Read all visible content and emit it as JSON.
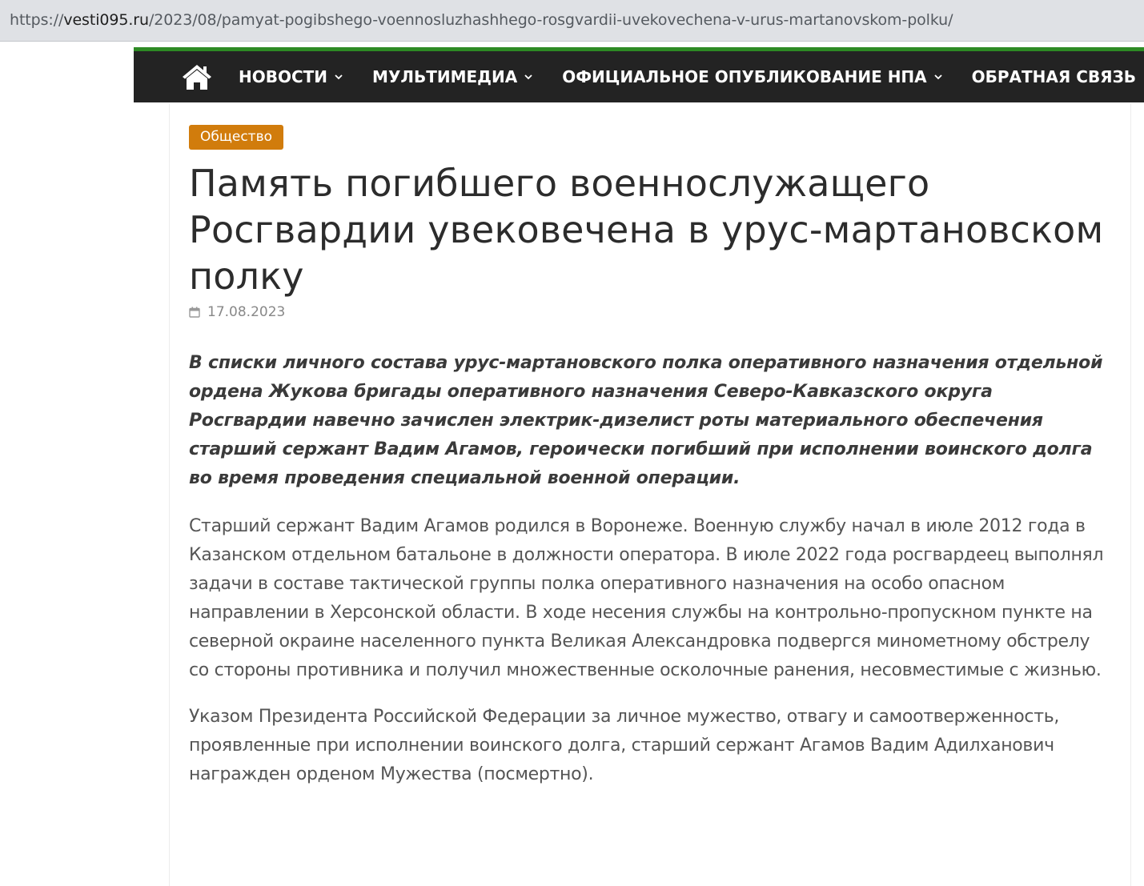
{
  "browser": {
    "url_scheme": "https://",
    "url_host": "vesti095.ru",
    "url_path": "/2023/08/pamyat-pogibshego-voennosluzhashhego-rosgvardii-uvekovechena-v-urus-martanovskom-polku/"
  },
  "nav": {
    "home_icon": "home-icon",
    "items": [
      {
        "label": "НОВОСТИ",
        "has_dropdown": true
      },
      {
        "label": "МУЛЬТИМЕДИА",
        "has_dropdown": true
      },
      {
        "label": "ОФИЦИАЛЬНОЕ ОПУБЛИКОВАНИЕ НПА",
        "has_dropdown": true
      },
      {
        "label": "ОБРАТНАЯ СВЯЗЬ",
        "has_dropdown": false
      }
    ]
  },
  "article": {
    "category": "Общество",
    "title": "Память погибшего военнослужащего Росгвардии увековечена в урус-мартановском полку",
    "date": "17.08.2023",
    "lead": "В списки личного состава урус-мартановского полка оперативного назначения отдельной ордена Жукова бригады оперативного назначения Северо-Кавказского округа Росгвардии навечно зачислен электрик-дизелист роты материального обеспечения старший сержант Вадим Агамов, героически погибший при исполнении воинского долга во время проведения специальной военной операции.",
    "paragraphs": [
      "Старший сержант Вадим Агамов родился в Воронеже. Военную службу начал в июле 2012 года в Казанском отдельном батальоне в должности оператора. В июле 2022 года росгвардеец выполнял задачи в составе тактической группы полка оперативного назначения на особо опасном направлении в Херсонской области. В ходе несения службы на контрольно-пропускном пункте на северной окраине населенного пункта Великая Александровка подвергся минометному обстрелу со стороны противника и получил множественные осколочные ранения, несовместимые с жизнью.",
      "Указом Президента Российской Федерации за личное мужество, отвагу и самоотверженность, проявленные при исполнении воинского долга, старший сержант Агамов Вадим Адилханович награжден орденом Мужества (посмертно)."
    ]
  },
  "colors": {
    "nav_bg": "#232323",
    "nav_accent": "#2d8a24",
    "category_bg": "#d17c0c"
  }
}
